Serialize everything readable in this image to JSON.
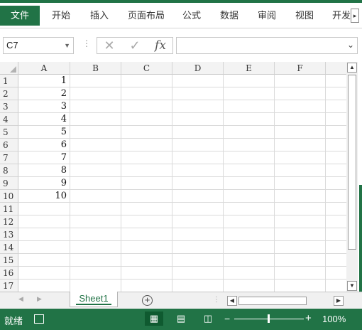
{
  "ribbon": {
    "tabs": [
      "文件",
      "开始",
      "插入",
      "页面布局",
      "公式",
      "数据",
      "审阅",
      "视图",
      "开发"
    ],
    "scroll_glyph": "▸"
  },
  "formula_bar": {
    "name_box": "C7",
    "cancel_glyph": "✕",
    "enter_glyph": "✓",
    "fx_label": "fx",
    "value": ""
  },
  "sheet": {
    "columns": [
      "A",
      "B",
      "C",
      "D",
      "E",
      "F"
    ],
    "rows": [
      "1",
      "2",
      "3",
      "4",
      "5",
      "6",
      "7",
      "8",
      "9",
      "10",
      "11",
      "12",
      "13",
      "14",
      "15",
      "16",
      "17"
    ],
    "column_a_values": [
      "1",
      "2",
      "3",
      "4",
      "5",
      "6",
      "7",
      "8",
      "9",
      "10"
    ]
  },
  "sheet_tabs": {
    "active": "Sheet1",
    "add_glyph": "+"
  },
  "status_bar": {
    "ready_text": "就绪",
    "zoom_minus": "−",
    "zoom_plus": "+",
    "zoom_level": "100%",
    "zoom_fraction": 0.5
  },
  "colors": {
    "accent": "#217346"
  },
  "icons": {
    "cancel": "cancel-icon",
    "enter": "enter-icon",
    "add_sheet": "add-sheet-icon",
    "macro": "macro-recording-icon"
  }
}
